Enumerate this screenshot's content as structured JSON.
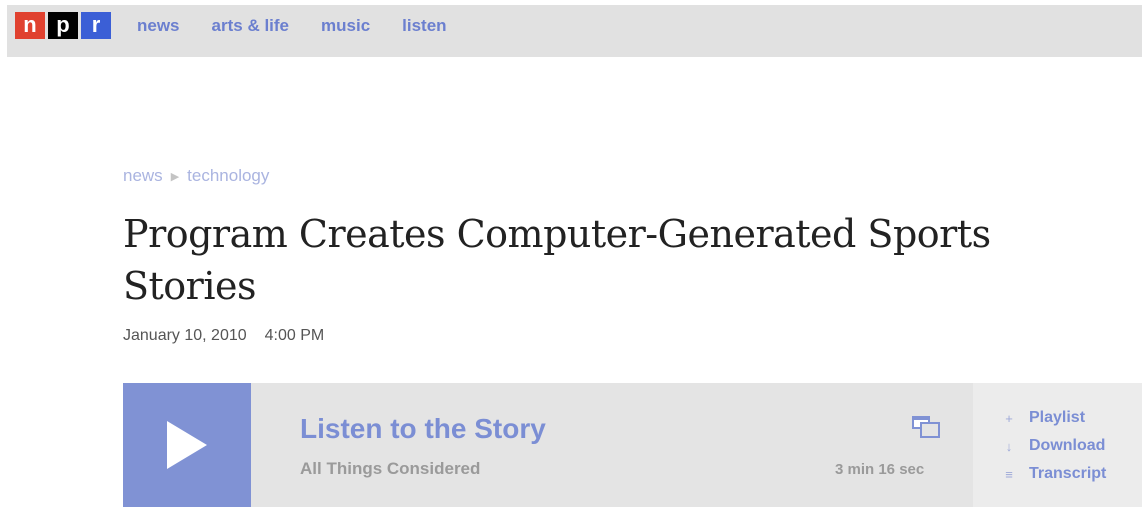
{
  "logo": {
    "letters": [
      "n",
      "p",
      "r"
    ]
  },
  "nav": [
    {
      "label": "news"
    },
    {
      "label": "arts & life"
    },
    {
      "label": "music"
    },
    {
      "label": "listen"
    }
  ],
  "breadcrumb": {
    "section": "news",
    "subsection": "technology"
  },
  "article": {
    "title": "Program Creates Computer-Generated Sports Stories",
    "date": "January 10, 2010",
    "time": "4:00 PM"
  },
  "player": {
    "title": "Listen to the Story",
    "program": "All Things Considered",
    "duration": "3 min 16 sec",
    "actions": [
      {
        "label": "Playlist",
        "icon": "plus-icon",
        "glyph": "+"
      },
      {
        "label": "Download",
        "icon": "download-arrow-icon",
        "glyph": "↓"
      },
      {
        "label": "Transcript",
        "icon": "transcript-lines-icon",
        "glyph": "≡"
      }
    ]
  },
  "colors": {
    "nav_link": "#6b7fcf",
    "play_button": "#8092d4",
    "logo_n": "#e0412f",
    "logo_p": "#000000",
    "logo_r": "#3b5fd6"
  }
}
